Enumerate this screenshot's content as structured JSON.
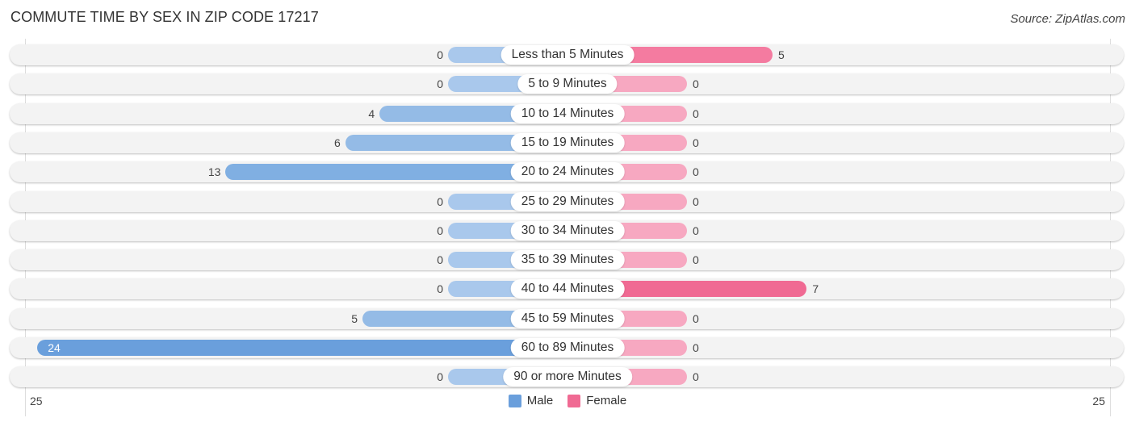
{
  "title": "COMMUTE TIME BY SEX IN ZIP CODE 17217",
  "source": "Source: ZipAtlas.com",
  "colors": {
    "male": "#a9c8ec",
    "male_strong": "#6a9fdc",
    "female": "#f7a8c1",
    "female_strong": "#f06a93"
  },
  "chart_data": {
    "type": "bar",
    "orientation": "diverging-horizontal",
    "title": "COMMUTE TIME BY SEX IN ZIP CODE 17217",
    "categories": [
      "Less than 5 Minutes",
      "5 to 9 Minutes",
      "10 to 14 Minutes",
      "15 to 19 Minutes",
      "20 to 24 Minutes",
      "25 to 29 Minutes",
      "30 to 34 Minutes",
      "35 to 39 Minutes",
      "40 to 44 Minutes",
      "45 to 59 Minutes",
      "60 to 89 Minutes",
      "90 or more Minutes"
    ],
    "series": [
      {
        "name": "Male",
        "values": [
          0,
          0,
          4,
          6,
          13,
          0,
          0,
          0,
          0,
          5,
          24,
          0
        ]
      },
      {
        "name": "Female",
        "values": [
          5,
          0,
          0,
          0,
          0,
          0,
          0,
          0,
          7,
          0,
          0,
          0
        ]
      }
    ],
    "axis": {
      "left_tick": "25",
      "right_tick": "25",
      "max": 25
    },
    "legend": [
      "Male",
      "Female"
    ],
    "legend_position": "bottom-center"
  }
}
